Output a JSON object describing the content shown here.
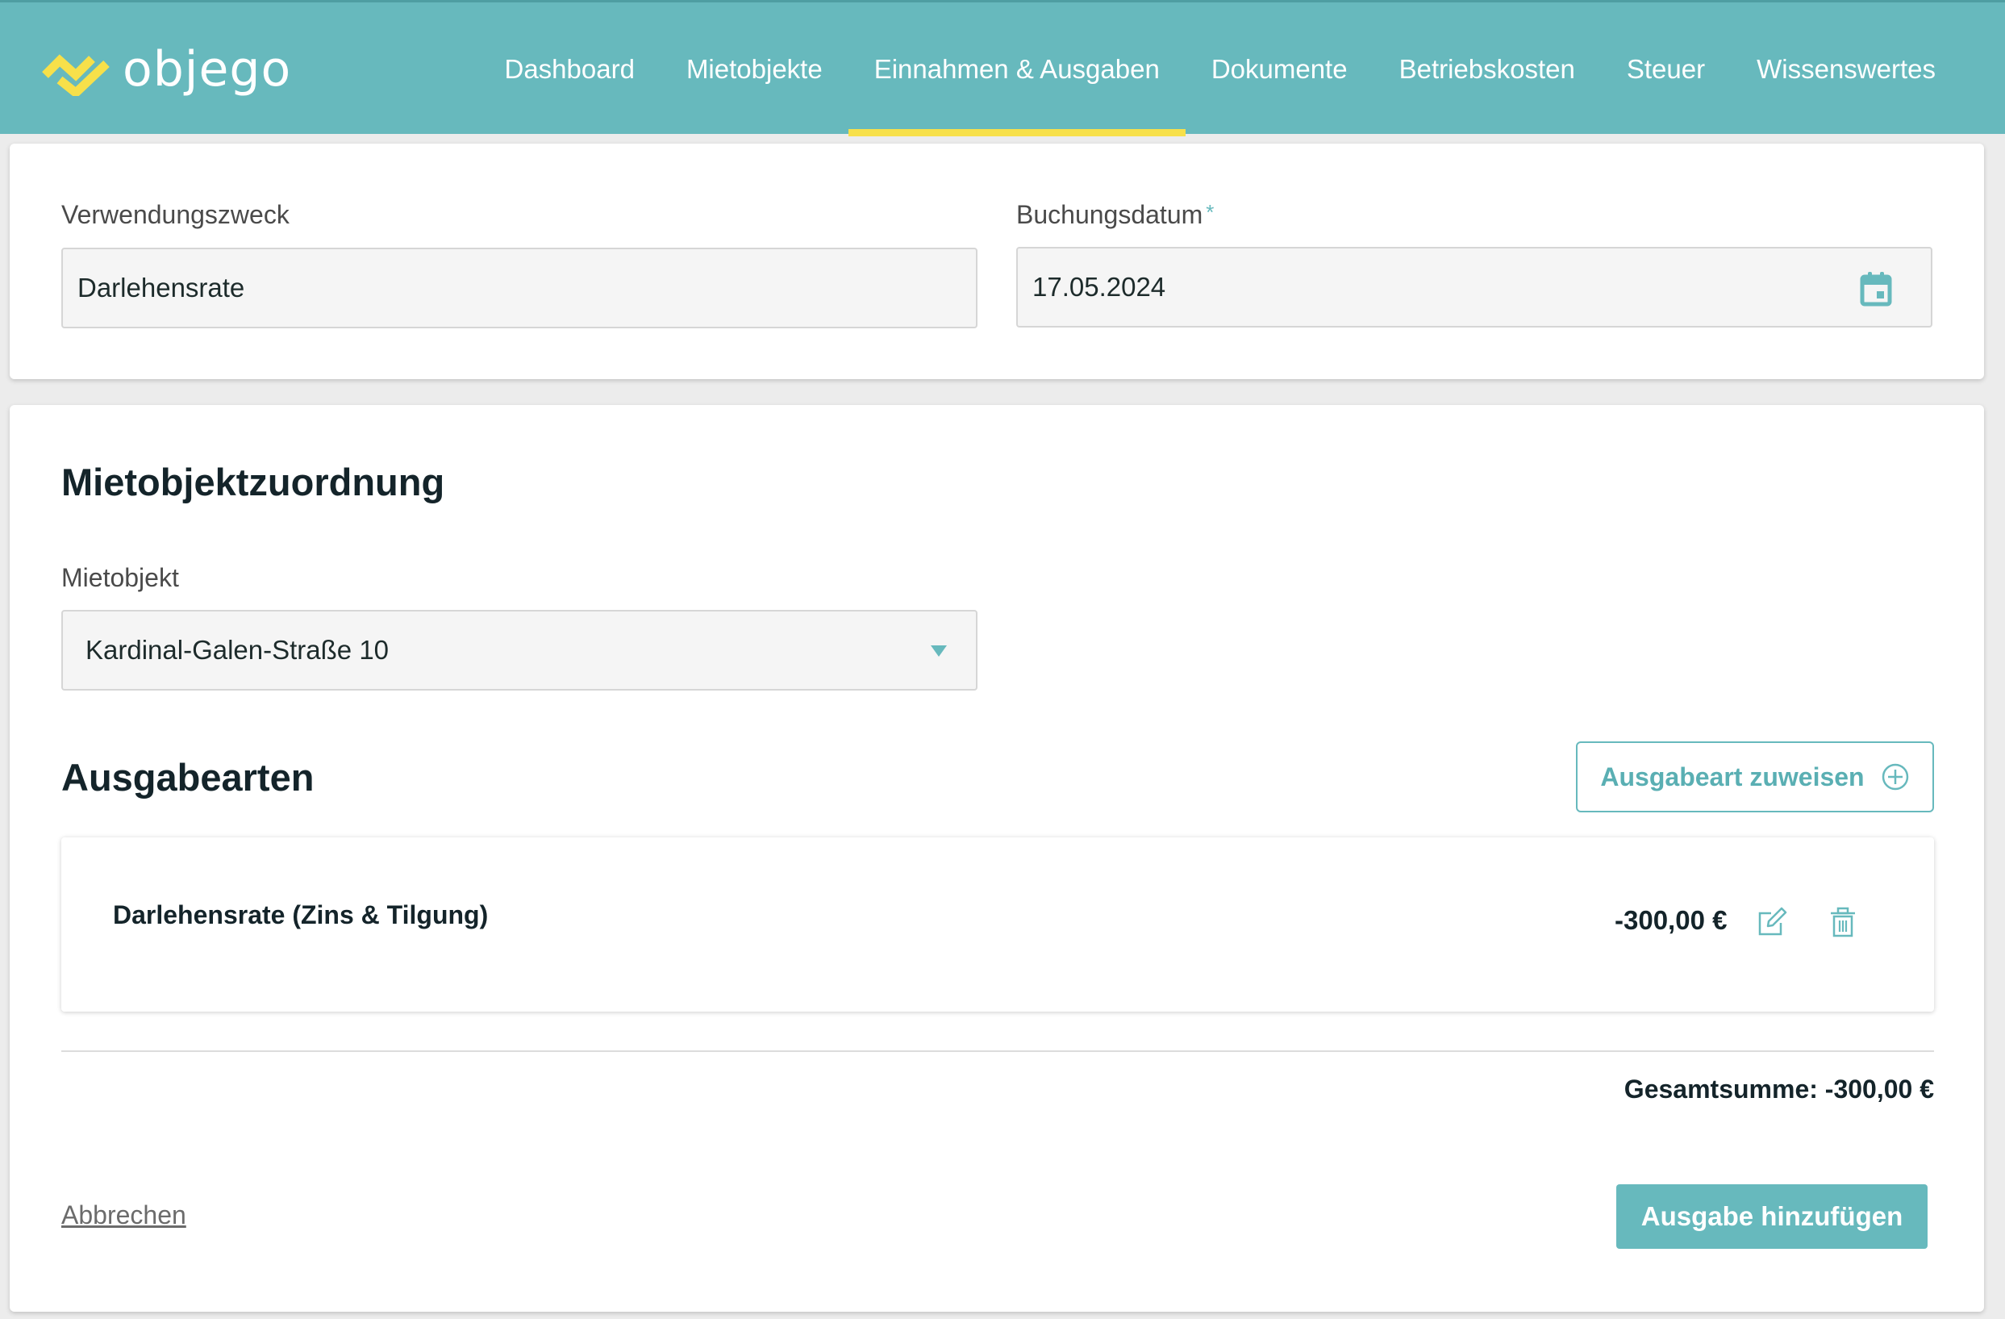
{
  "brand": {
    "name": "objego"
  },
  "nav": {
    "items": [
      {
        "label": "Dashboard"
      },
      {
        "label": "Mietobjekte"
      },
      {
        "label": "Einnahmen & Ausgaben",
        "active": true
      },
      {
        "label": "Dokumente"
      },
      {
        "label": "Betriebskosten"
      },
      {
        "label": "Steuer"
      },
      {
        "label": "Wissenswertes"
      }
    ]
  },
  "booking": {
    "purpose_label": "Verwendungszweck",
    "purpose_value": "Darlehensrate",
    "date_label": "Buchungsdatum",
    "date_required_mark": "*",
    "date_value": "17.05.2024"
  },
  "assignment": {
    "title": "Mietobjektzuordnung",
    "property_label": "Mietobjekt",
    "property_value": "Kardinal-Galen-Straße 10"
  },
  "expense_types": {
    "title": "Ausgabearten",
    "assign_button_label": "Ausgabeart zuweisen",
    "items": [
      {
        "label": "Darlehensrate (Zins & Tilgung)",
        "amount": "-300,00 €"
      }
    ],
    "total_text": "Gesamtsumme: -300,00 €"
  },
  "actions": {
    "cancel_label": "Abbrechen",
    "submit_label": "Ausgabe hinzufügen"
  },
  "colors": {
    "header_bg": "#67b9bd",
    "active_tab_indicator": "#f7e04a",
    "accent": "#67b9bd",
    "logo_yellow": "#f7e04a"
  },
  "icons": {
    "logo": "objego-logo-icon",
    "calendar": "calendar-icon",
    "dropdown": "chevron-down-icon",
    "add": "plus-circle-icon",
    "edit": "edit-icon",
    "delete": "trash-icon"
  }
}
